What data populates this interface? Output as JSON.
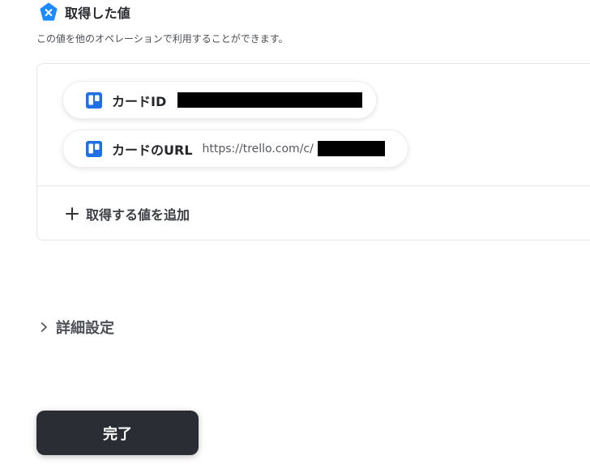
{
  "section": {
    "title": "取得した値",
    "description": "この値を他のオペレーションで利用することができます。",
    "icon": "yoom-x-hexagon-icon",
    "accent_color": "#1a8cff"
  },
  "fields": [
    {
      "icon": "trello-icon",
      "label": "カードID",
      "value": "",
      "redacted": true
    },
    {
      "icon": "trello-icon",
      "label": "カードのURL",
      "value": "https://trello.com/c/",
      "redacted": true
    }
  ],
  "add_field": {
    "icon": "plus-icon",
    "label": "取得する値を追加"
  },
  "advanced_settings": {
    "icon": "chevron-right-icon",
    "label": "詳細設定"
  },
  "done_button": {
    "label": "完了"
  }
}
